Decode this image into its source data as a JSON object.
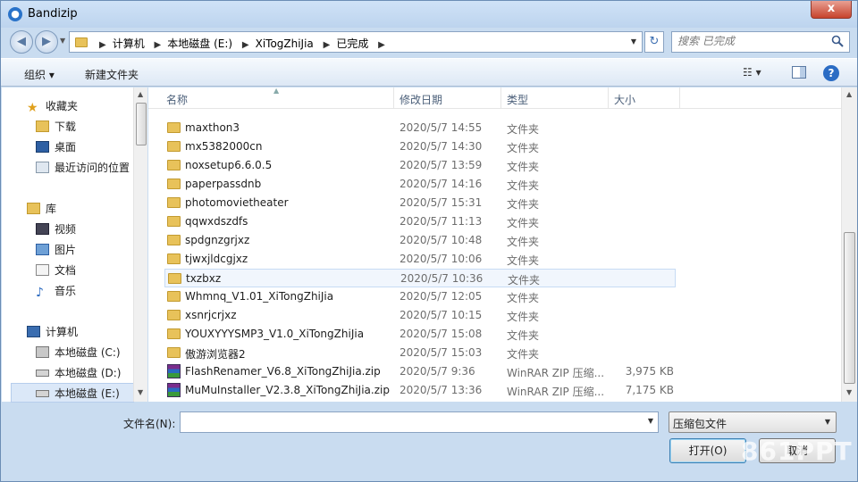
{
  "window": {
    "title": "Bandizip",
    "close_glyph": "x"
  },
  "address": {
    "crumbs": [
      "计算机",
      "本地磁盘 (E:)",
      "XiTogZhiJia",
      "已完成"
    ],
    "search_placeholder": "搜索 已完成"
  },
  "toolbar": {
    "organize": "组织 ▾",
    "new_folder": "新建文件夹"
  },
  "nav": {
    "favorites": "收藏夹",
    "downloads": "下载",
    "desktop": "桌面",
    "recent": "最近访问的位置",
    "libraries": "库",
    "videos": "视频",
    "pictures": "图片",
    "documents": "文档",
    "music": "音乐",
    "computer": "计算机",
    "drive_c": "本地磁盘 (C:)",
    "drive_d": "本地磁盘 (D:)",
    "drive_e": "本地磁盘 (E:)"
  },
  "columns": {
    "name": "名称",
    "date": "修改日期",
    "type": "类型",
    "size": "大小"
  },
  "files": [
    {
      "name": "maxthon3",
      "date": "2020/5/7 14:55",
      "type": "文件夹",
      "size": "",
      "kind": "folder"
    },
    {
      "name": "mx5382000cn",
      "date": "2020/5/7 14:30",
      "type": "文件夹",
      "size": "",
      "kind": "folder"
    },
    {
      "name": "noxsetup6.6.0.5",
      "date": "2020/5/7 13:59",
      "type": "文件夹",
      "size": "",
      "kind": "folder"
    },
    {
      "name": "paperpassdnb",
      "date": "2020/5/7 14:16",
      "type": "文件夹",
      "size": "",
      "kind": "folder"
    },
    {
      "name": "photomovietheater",
      "date": "2020/5/7 15:31",
      "type": "文件夹",
      "size": "",
      "kind": "folder"
    },
    {
      "name": "qqwxdszdfs",
      "date": "2020/5/7 11:13",
      "type": "文件夹",
      "size": "",
      "kind": "folder"
    },
    {
      "name": "spdgnzgrjxz",
      "date": "2020/5/7 10:48",
      "type": "文件夹",
      "size": "",
      "kind": "folder"
    },
    {
      "name": "tjwxjldcgjxz",
      "date": "2020/5/7 10:06",
      "type": "文件夹",
      "size": "",
      "kind": "folder"
    },
    {
      "name": "txzbxz",
      "date": "2020/5/7 10:36",
      "type": "文件夹",
      "size": "",
      "kind": "folder"
    },
    {
      "name": "Whmnq_V1.01_XiTongZhiJia",
      "date": "2020/5/7 12:05",
      "type": "文件夹",
      "size": "",
      "kind": "folder"
    },
    {
      "name": "xsnrjcrjxz",
      "date": "2020/5/7 10:15",
      "type": "文件夹",
      "size": "",
      "kind": "folder"
    },
    {
      "name": "YOUXYYYSMP3_V1.0_XiTongZhiJia",
      "date": "2020/5/7 15:08",
      "type": "文件夹",
      "size": "",
      "kind": "folder"
    },
    {
      "name": "傲游浏览器2",
      "date": "2020/5/7 15:03",
      "type": "文件夹",
      "size": "",
      "kind": "folder"
    },
    {
      "name": "FlashRenamer_V6.8_XiTongZhiJia.zip",
      "date": "2020/5/7 9:36",
      "type": "WinRAR ZIP 压缩...",
      "size": "3,975 KB",
      "kind": "zip"
    },
    {
      "name": "MuMuInstaller_V2.3.8_XiTongZhiJia.zip",
      "date": "2020/5/7 13:36",
      "type": "WinRAR ZIP 压缩...",
      "size": "7,175 KB",
      "kind": "zip"
    }
  ],
  "selected_row": "txzbxz",
  "bottom": {
    "filename_label": "文件名(N):",
    "filename_value": "",
    "filetype": "压缩包文件",
    "open_button": "打开(O)",
    "cancel_button": "取消"
  },
  "watermark": "861PPT"
}
